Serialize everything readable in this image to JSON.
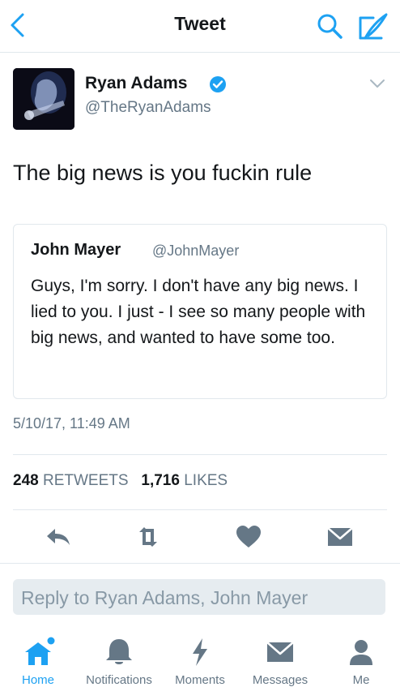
{
  "header": {
    "title": "Tweet"
  },
  "tweet": {
    "author_name": "Ryan Adams",
    "author_handle": "@TheRyanAdams",
    "text": "The big news is you fuckin rule",
    "timestamp": "5/10/17, 11:49 AM",
    "retweets": "248",
    "retweets_label": "RETWEETS",
    "likes": "1,716",
    "likes_label": "LIKES"
  },
  "quoted": {
    "author_name": "John Mayer",
    "author_handle": "@JohnMayer",
    "text": "Guys, I'm sorry. I don't have any big news. I lied to you. I just - I see so many people with big news, and wanted to have some too."
  },
  "reply": {
    "placeholder": "Reply to Ryan Adams, John Mayer"
  },
  "tabs": [
    {
      "label": "Home",
      "icon": "home-icon",
      "active": true
    },
    {
      "label": "Notifications",
      "icon": "bell-icon"
    },
    {
      "label": "Moments",
      "icon": "lightning-icon"
    },
    {
      "label": "Messages",
      "icon": "envelope-icon"
    },
    {
      "label": "Me",
      "icon": "person-icon"
    }
  ],
  "colors": {
    "accent": "#1da1f2",
    "secondary": "#657786",
    "text": "#14171a",
    "border": "#e1e8ed"
  }
}
